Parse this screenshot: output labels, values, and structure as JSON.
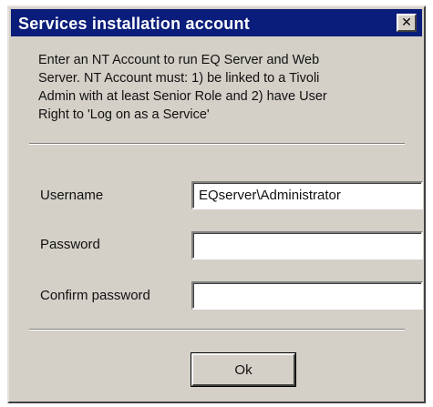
{
  "window": {
    "title": "Services installation account",
    "close_glyph": "✕"
  },
  "description": {
    "lines": [
      "Enter an NT Account to run EQ Server and Web",
      "Server.  NT Account must: 1) be linked to a Tivoli",
      "Admin with at least Senior Role and 2) have User",
      "Right to 'Log on as a Service'"
    ]
  },
  "form": {
    "username_label": "Username",
    "username_value": "EQserver\\Administrator",
    "password_label": "Password",
    "password_value": "",
    "confirm_label": "Confirm password",
    "confirm_value": ""
  },
  "buttons": {
    "ok_label": "Ok"
  },
  "icons": {
    "close": "close-icon"
  },
  "colors": {
    "titlebar": "#0a1d7a",
    "dialog_face": "#d4d0c8"
  }
}
